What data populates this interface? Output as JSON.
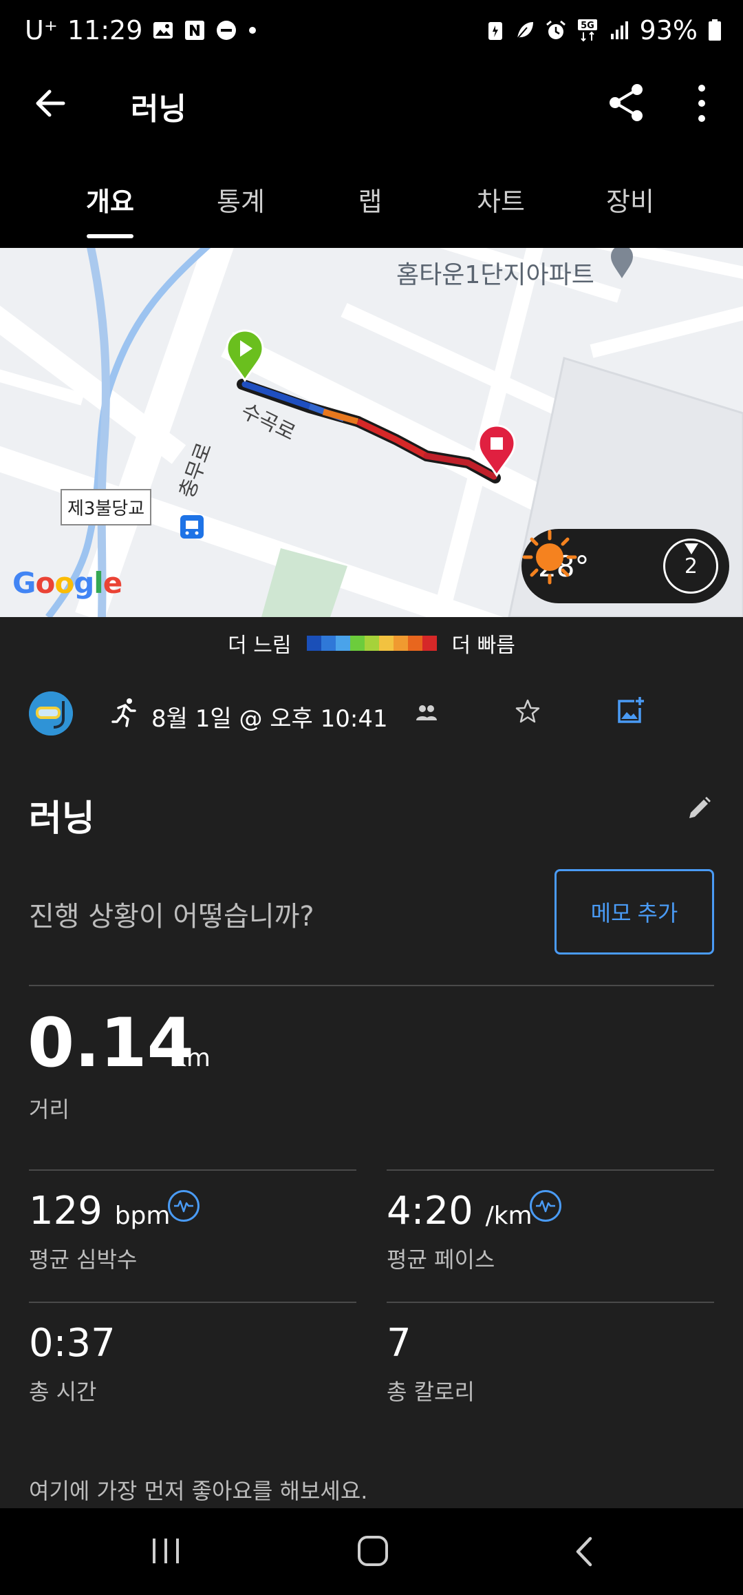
{
  "status_bar": {
    "carrier": "U⁺",
    "time": "11:29",
    "network": "5G",
    "battery": "93%"
  },
  "app_bar": {
    "title": "러닝"
  },
  "tabs": [
    {
      "label": "개요",
      "active": true
    },
    {
      "label": "통계",
      "active": false
    },
    {
      "label": "랩",
      "active": false
    },
    {
      "label": "차트",
      "active": false
    },
    {
      "label": "장비",
      "active": false
    }
  ],
  "map": {
    "poi_label": "홈타운1단지아파트",
    "road_label_1": "수곡로",
    "road_label_2": "충무로",
    "bridge_label": "제3불당교",
    "google_logo": "Google",
    "weather": {
      "temperature": "28°",
      "wind_speed": "2"
    }
  },
  "pace_legend": {
    "slow_label": "더 느림",
    "fast_label": "더 빠름",
    "colors": [
      "#1a4fb8",
      "#2f78d8",
      "#4aa3ea",
      "#6ccc3c",
      "#a6d23a",
      "#f2c240",
      "#f09a30",
      "#e8661e",
      "#d62828"
    ]
  },
  "activity": {
    "datetime": "8월 1일 @ 오후 10:41",
    "title": "러닝",
    "progress_question": "진행 상황이 어떻습니까?",
    "memo_button": "메모 추가",
    "distance": {
      "value": "0.14",
      "unit": "km",
      "label": "거리"
    },
    "heart_rate": {
      "value": "129",
      "unit": "bpm",
      "label": "평균 심박수"
    },
    "pace": {
      "value": "4:20",
      "unit": "/km",
      "label": "평균 페이스"
    },
    "time": {
      "value": "0:37",
      "label": "총 시간"
    },
    "calories": {
      "value": "7",
      "label": "총 칼로리"
    },
    "like_prompt": "여기에 가장 먼저 좋아요를 해보세요."
  },
  "colors": {
    "accent": "#4a9bf5",
    "start_marker": "#6abf1e",
    "end_marker": "#e02040"
  }
}
